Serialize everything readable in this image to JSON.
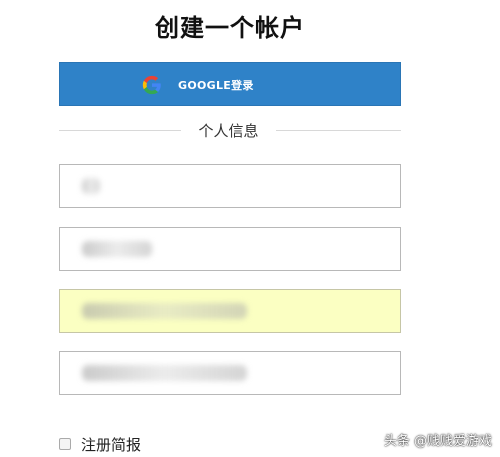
{
  "page": {
    "title": "创建一个帐户"
  },
  "google_signin": {
    "label": "GOOGLE登录",
    "icon": "google-g-icon",
    "color": "#2f82c8"
  },
  "personal_info": {
    "section_label": "个人信息",
    "fields": [
      {
        "name": "field-1",
        "value": "",
        "highlighted": false
      },
      {
        "name": "field-2",
        "value": "",
        "highlighted": false
      },
      {
        "name": "field-3",
        "value": "",
        "highlighted": true
      },
      {
        "name": "field-4",
        "value": "",
        "highlighted": false
      }
    ],
    "autofill_highlight_color": "#fbffc2"
  },
  "newsletter": {
    "label": "注册简报",
    "checked": false
  },
  "watermark": {
    "text": "头条 @贱贱爱游戏"
  }
}
